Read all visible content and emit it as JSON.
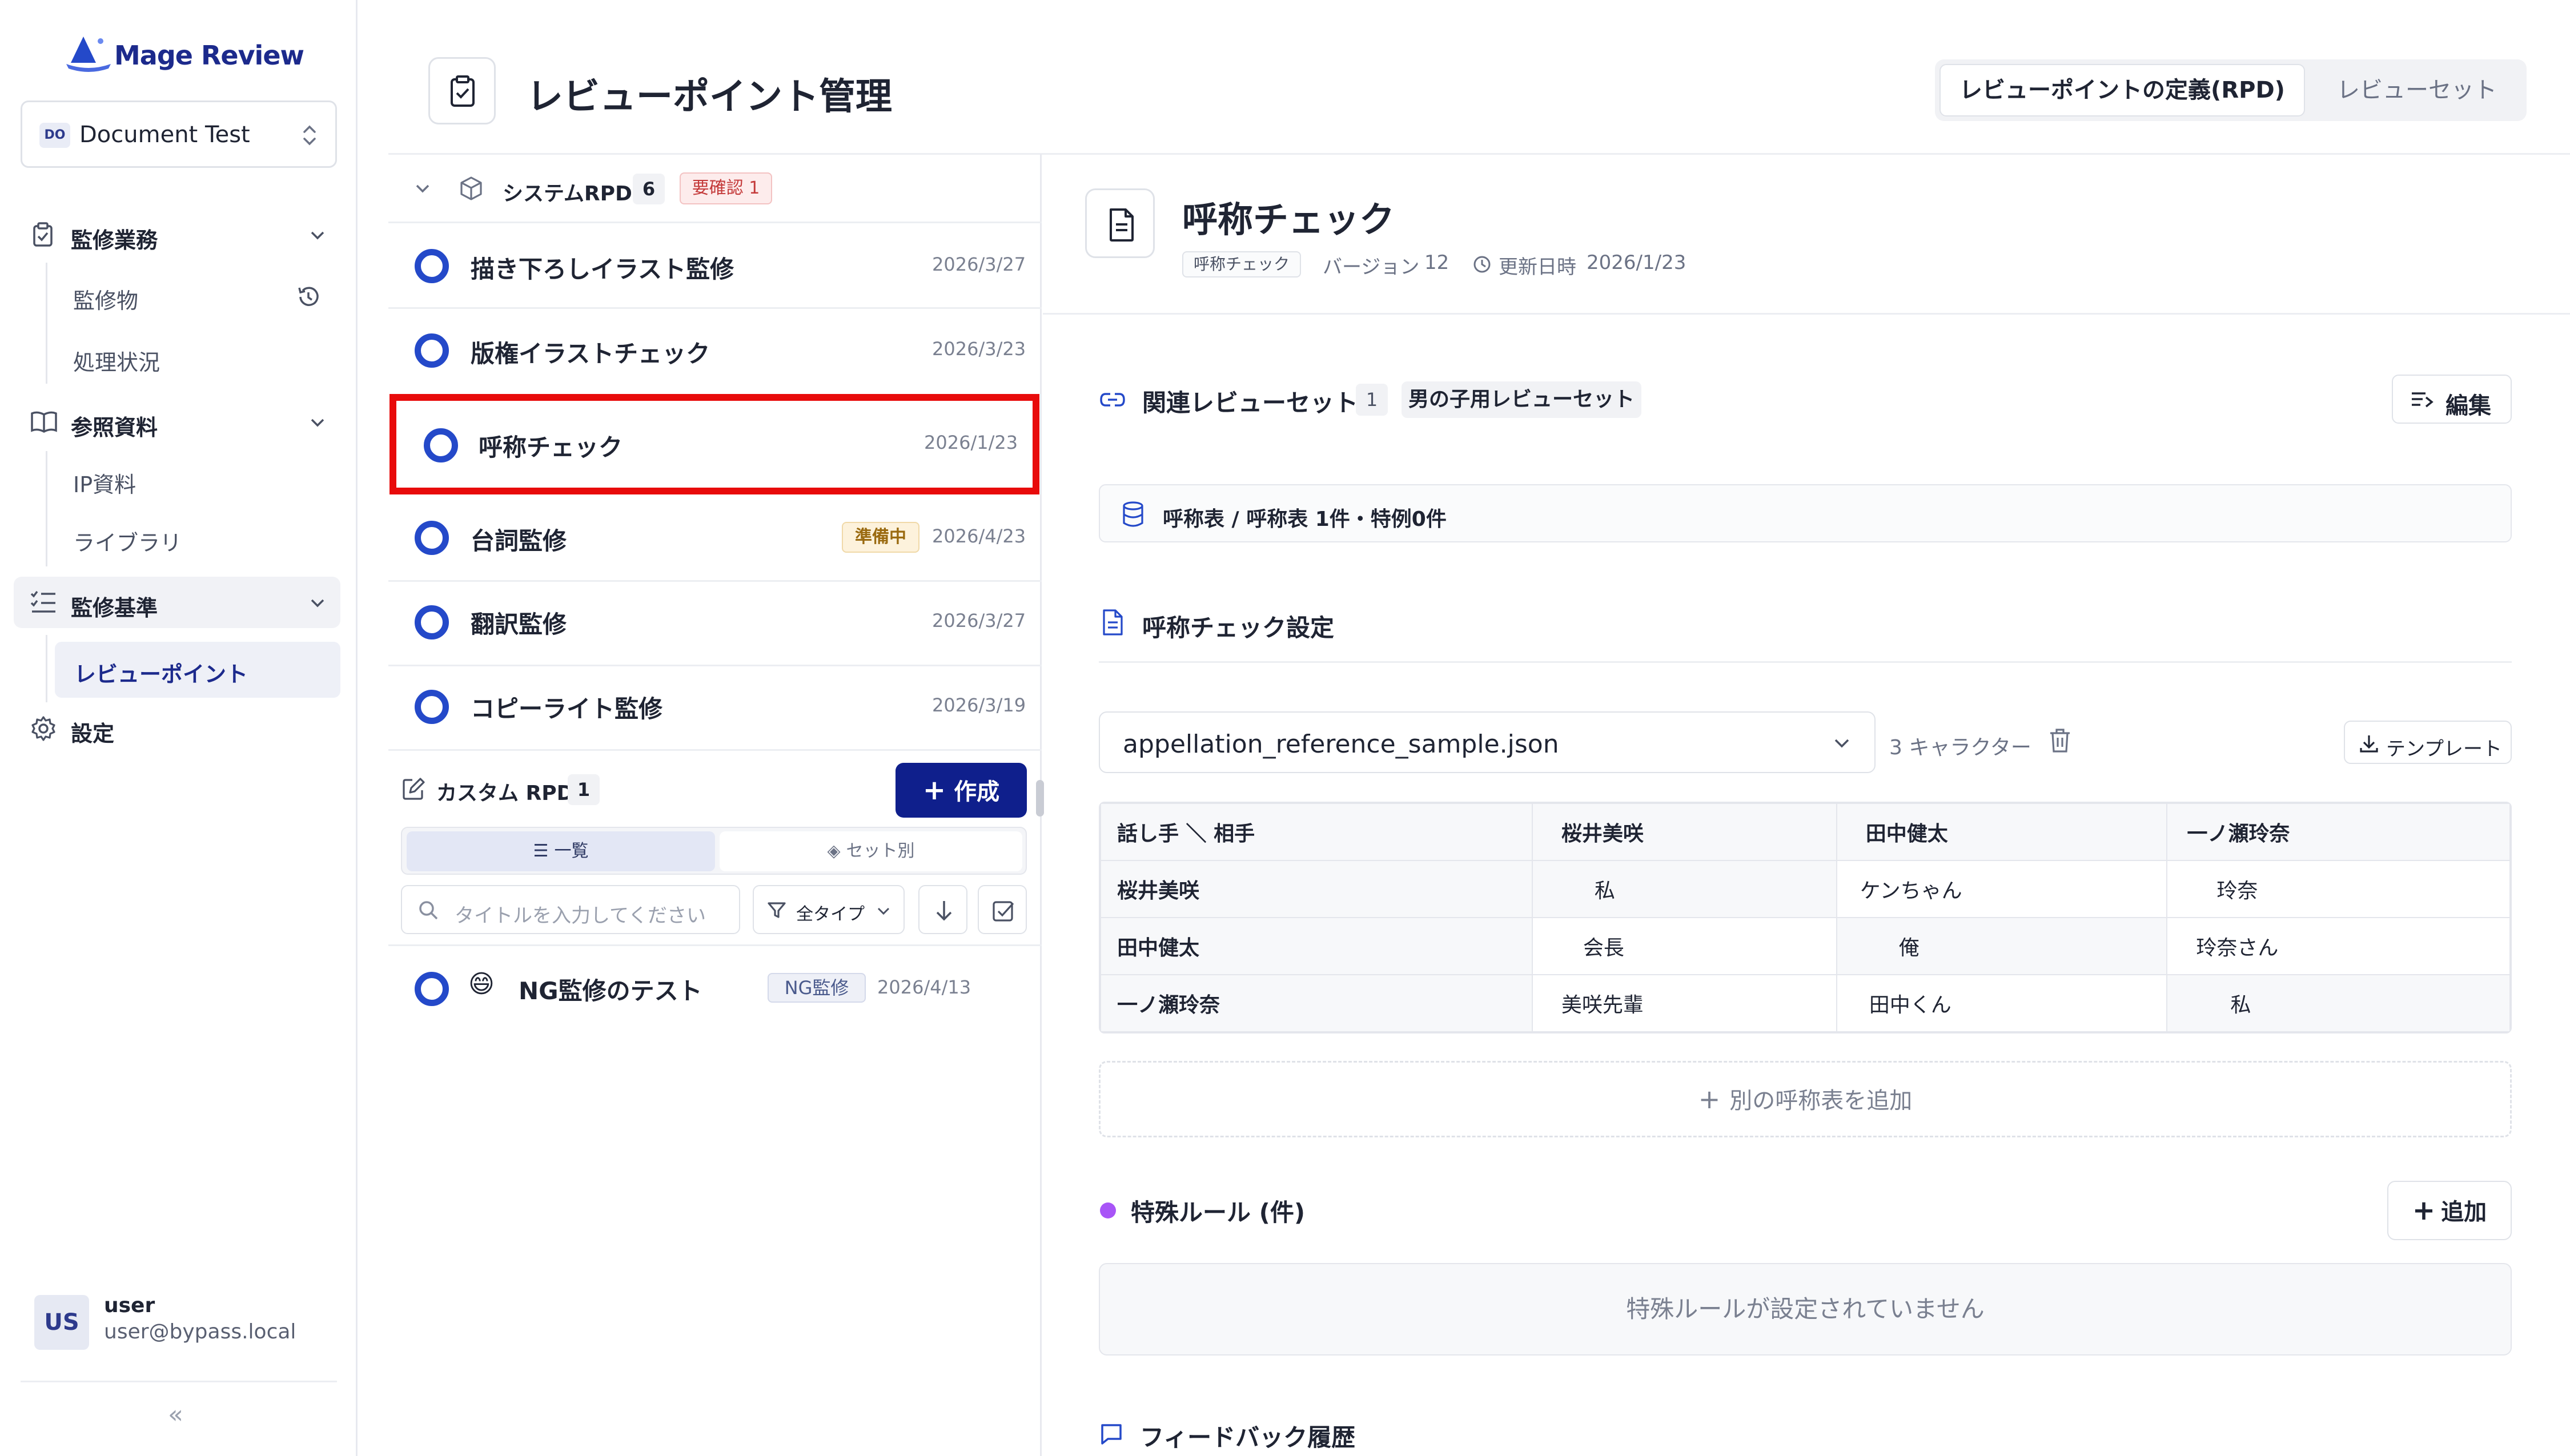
{
  "app": {
    "logo_text": "Mage Review",
    "project": {
      "badge": "DO",
      "name": "Document Test"
    }
  },
  "sidebar": {
    "sections": [
      {
        "label": "監修業務",
        "items": [
          "監修物",
          "処理状況"
        ]
      },
      {
        "label": "参照資料",
        "items": [
          "IP資料",
          "ライブラリ"
        ]
      },
      {
        "label": "監修基準",
        "items": [
          "レビューポイント"
        ]
      }
    ],
    "settings_label": "設定",
    "user": {
      "avatar": "US",
      "name": "user",
      "email": "user@bypass.local"
    },
    "collapse_glyph": "«"
  },
  "header": {
    "title": "レビューポイント管理",
    "tabs": [
      "レビューポイントの定義(RPD)",
      "レビューセット"
    ]
  },
  "system_rpd": {
    "label": "システムRPD",
    "count": "6",
    "warning": "要確認 1",
    "items": [
      {
        "title": "描き下ろしイラスト監修",
        "date": "2026/3/27",
        "badge": ""
      },
      {
        "title": "版権イラストチェック",
        "date": "2026/3/23",
        "badge": ""
      },
      {
        "title": "呼称チェック",
        "date": "2026/1/23",
        "badge": ""
      },
      {
        "title": "台詞監修",
        "date": "2026/4/23",
        "badge": "準備中"
      },
      {
        "title": "翻訳監修",
        "date": "2026/3/27",
        "badge": ""
      },
      {
        "title": "コピーライト監修",
        "date": "2026/3/19",
        "badge": ""
      }
    ]
  },
  "custom_rpd": {
    "label": "カスタム RPD",
    "count": "1",
    "create_label": "作成",
    "tabs": [
      "一覧",
      "セット別"
    ],
    "search_placeholder": "タイトルを入力してください",
    "filter_label": "全タイプ",
    "items": [
      {
        "emoji": "😄",
        "title": "NG監修のテスト",
        "badge": "NG監修",
        "date": "2026/4/13"
      }
    ]
  },
  "detail": {
    "title": "呼称チェック",
    "type_badge": "呼称チェック",
    "version_label": "バージョン",
    "version": "12",
    "updated_label": "更新日時",
    "updated": "2026/1/23",
    "related": {
      "label": "関連レビューセット",
      "count": "1",
      "set_name": "男の子用レビューセット",
      "edit_label": "編集"
    },
    "source_text": "呼称表 / 呼称表 1件・特例0件",
    "settings_title": "呼称チェック設定",
    "file": {
      "name": "appellation_reference_sample.json",
      "count_text": "3 キャラクター",
      "template_label": "テンプレート"
    },
    "table": {
      "header": [
        "話し手 ＼ 相手",
        "桜井美咲",
        "田中健太",
        "一ノ瀬玲奈"
      ],
      "rows": [
        [
          "桜井美咲",
          "私",
          "ケンちゃん",
          "玲奈"
        ],
        [
          "田中健太",
          "会長",
          "俺",
          "玲奈さん"
        ],
        [
          "一ノ瀬玲奈",
          "美咲先輩",
          "田中くん",
          "私"
        ]
      ]
    },
    "add_table_label": "別の呼称表を追加",
    "special_rules": {
      "title": "特殊ルール (件)",
      "add_label": "追加",
      "empty_text": "特殊ルールが設定されていません",
      "dot_color": "#a855f7"
    },
    "feedback_title": "フィードバック履歴"
  },
  "colors": {
    "accent": "#1c2a8c",
    "ring": "#2449c9",
    "selection": "#e80b0b"
  }
}
